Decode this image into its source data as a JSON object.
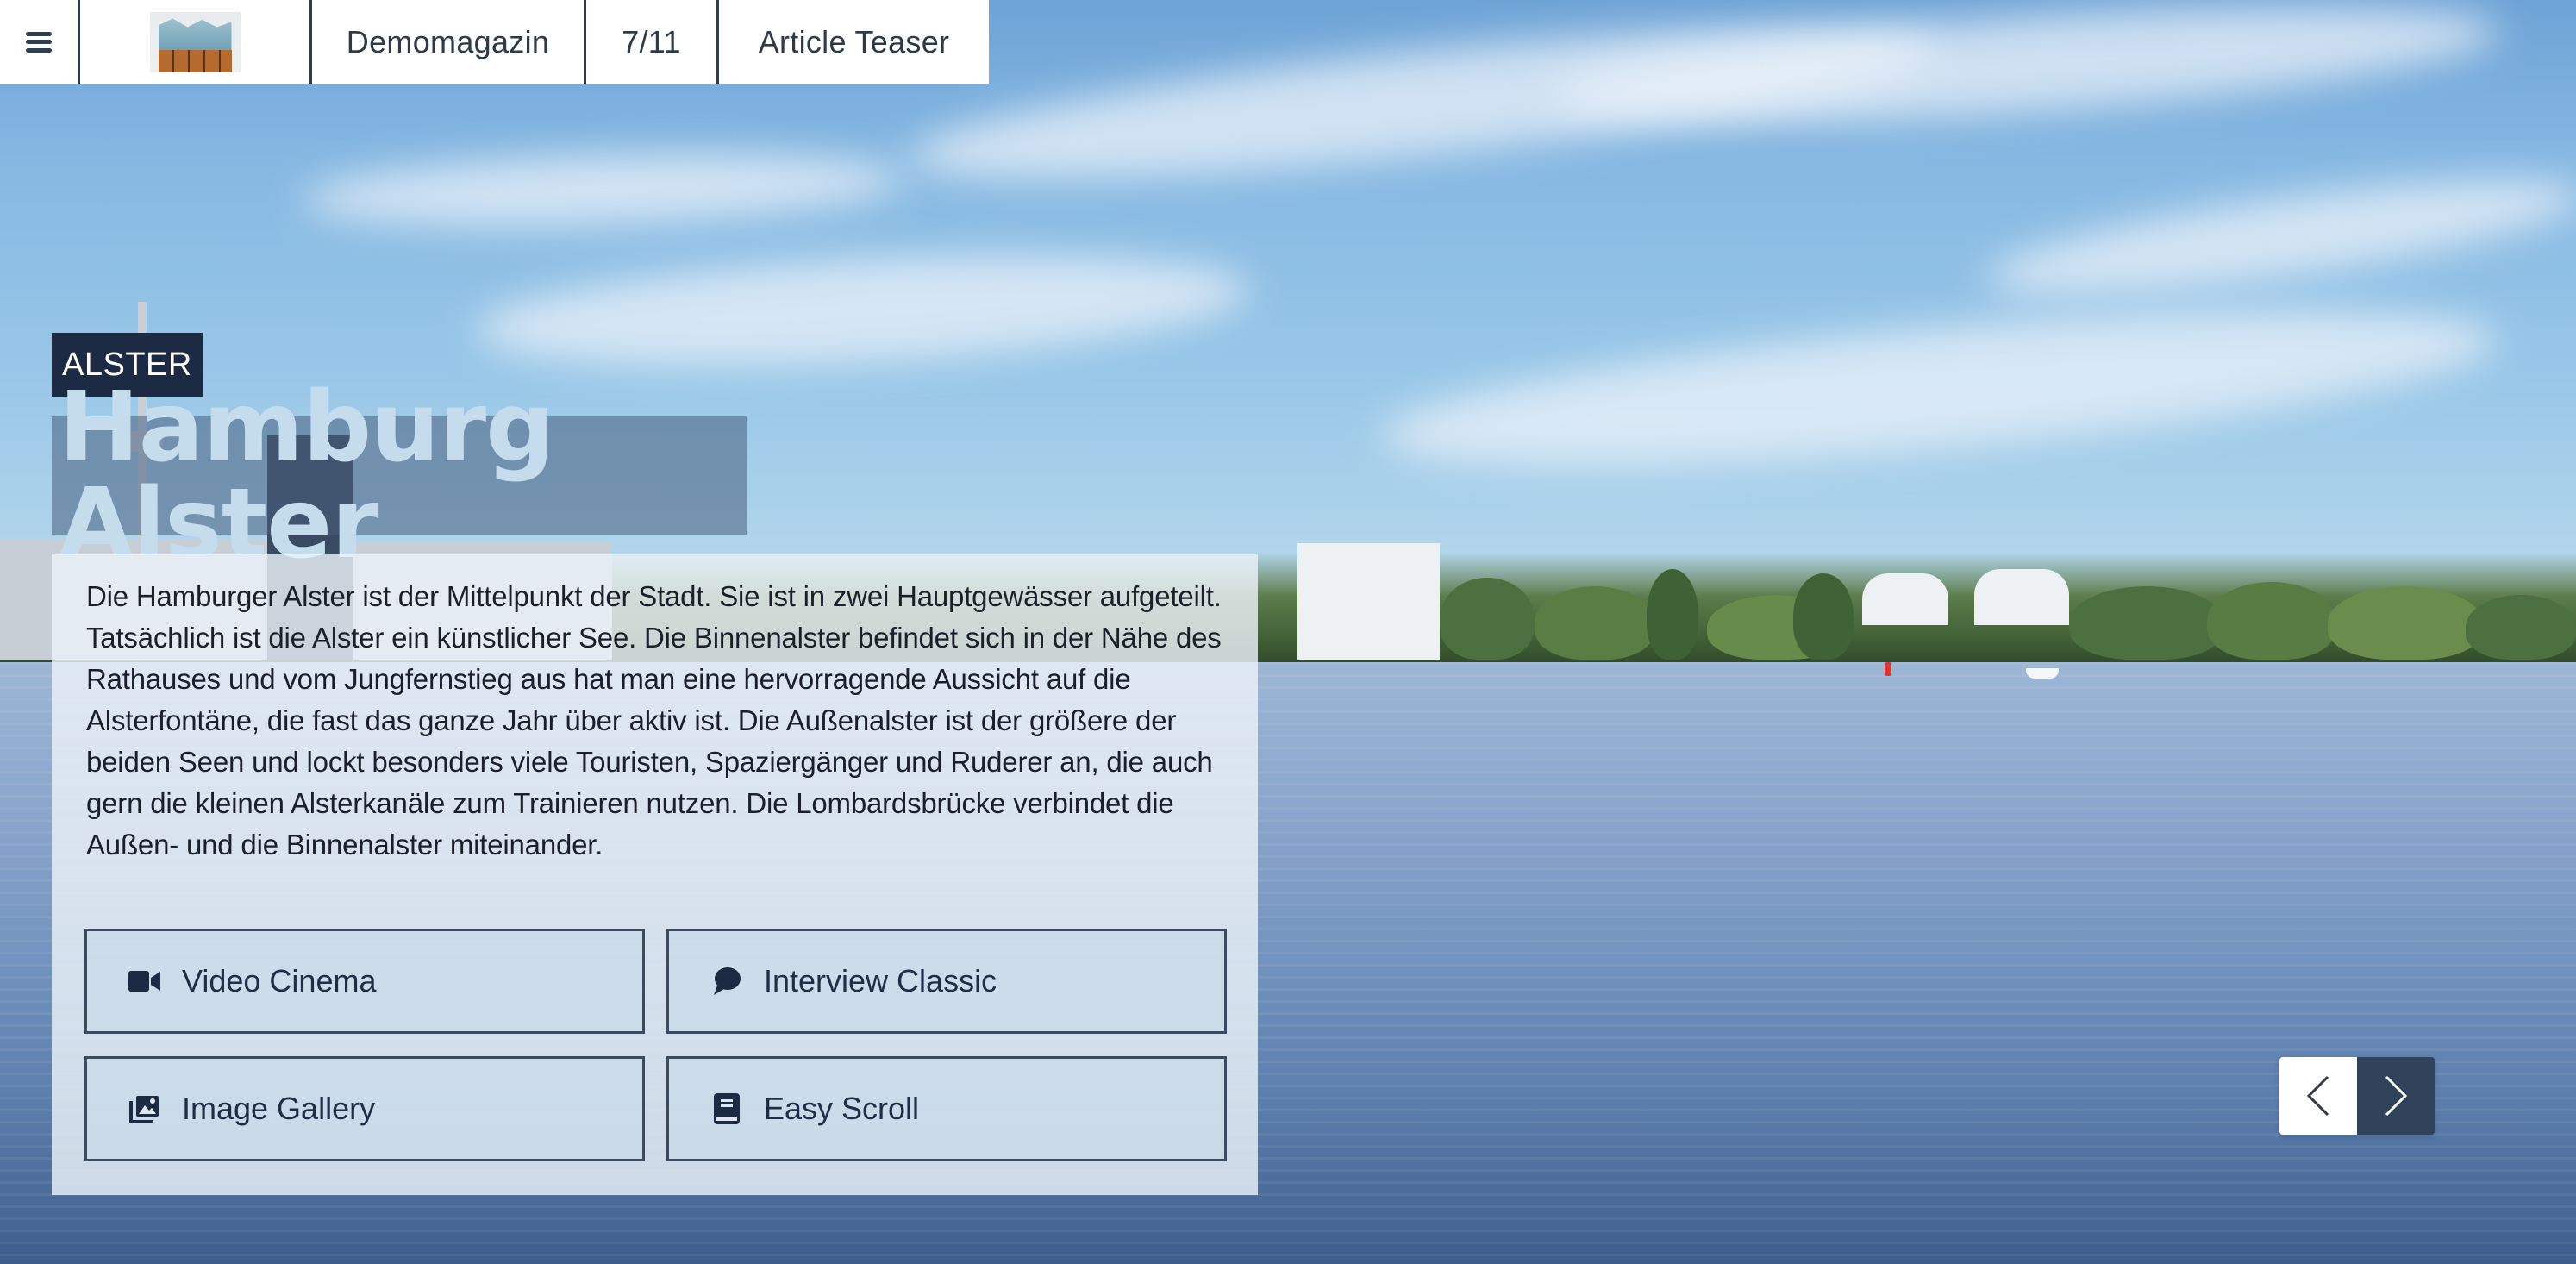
{
  "header": {
    "menu_icon": "hamburger-menu-icon",
    "logo_alt": "Elbphilharmonie",
    "magazine_name": "Demomagazin",
    "page_indicator": "7/11",
    "section_name": "Article Teaser"
  },
  "article": {
    "kicker": "ALSTER",
    "title": "Hamburg Alster",
    "body": "Die Hamburger Alster ist der Mittelpunkt der Stadt. Sie ist in zwei Hauptgewässer aufgeteilt. Tatsächlich ist die Alster ein künstlicher See. Die Binnenalster befindet sich in der Nähe des Rathauses und vom Jungfernstieg aus hat man eine hervorragende Aussicht auf die Alsterfontäne, die fast das ganze Jahr über aktiv ist. Die Außenalster ist der größere der beiden Seen und lockt besonders viele Touristen, Spaziergänger und Ruderer an, die auch gern die kleinen Alsterkanäle zum Trainieren nutzen. Die Lombardsbrücke verbindet die Außen- und die Binnenalster miteinander."
  },
  "tiles": [
    {
      "label": "Video Cinema",
      "icon": "video-camera-icon"
    },
    {
      "label": "Interview Classic",
      "icon": "speech-bubble-icon"
    },
    {
      "label": "Image Gallery",
      "icon": "image-gallery-icon"
    },
    {
      "label": "Easy Scroll",
      "icon": "book-icon"
    }
  ],
  "navigation": {
    "prev_icon": "chevron-left-icon",
    "next_icon": "chevron-right-icon"
  },
  "colors": {
    "primary_dark": "#1d2a44",
    "header_border": "#2c3e50",
    "nav_next_bg": "#2f4259",
    "title_text": "#c5dced"
  }
}
